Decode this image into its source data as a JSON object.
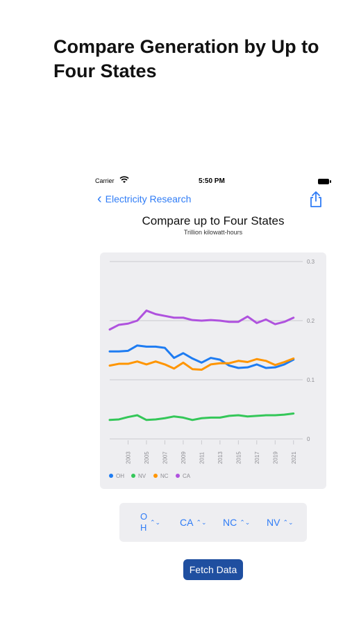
{
  "headline": "Compare Generation by Up to Four States",
  "status_bar": {
    "carrier": "Carrier",
    "time": "5:50 PM"
  },
  "nav": {
    "back_label": "Electricity Research"
  },
  "chart_header": {
    "title": "Compare up to Four States",
    "subtitle": "Trillion kilowatt-hours"
  },
  "chart_data": {
    "type": "line",
    "title": "Compare up to Four States",
    "subtitle": "Trillion kilowatt-hours",
    "x": [
      2001,
      2002,
      2003,
      2004,
      2005,
      2006,
      2007,
      2008,
      2009,
      2010,
      2011,
      2012,
      2013,
      2014,
      2015,
      2016,
      2017,
      2018,
      2019,
      2020,
      2021,
      2022
    ],
    "x_tick_labels": [
      "2003",
      "2005",
      "2007",
      "2009",
      "2011",
      "2013",
      "2015",
      "2017",
      "2019",
      "2021"
    ],
    "x_ticks": [
      2003,
      2005,
      2007,
      2009,
      2011,
      2013,
      2015,
      2017,
      2019,
      2021
    ],
    "y_ticks": [
      0,
      0.1,
      0.2,
      0.3
    ],
    "y_tick_labels": [
      "0",
      "0.1",
      "0.2",
      "0.3"
    ],
    "ylim": [
      0,
      0.3
    ],
    "grid": true,
    "legend_position": "bottom-left",
    "series": [
      {
        "name": "OH",
        "color": "#1e7cf2",
        "values": [
          0.148,
          0.148,
          0.149,
          0.158,
          0.156,
          0.156,
          0.154,
          0.137,
          0.145,
          0.136,
          0.129,
          0.137,
          0.134,
          0.124,
          0.12,
          0.121,
          0.126,
          0.12,
          0.121,
          0.126,
          0.134
        ]
      },
      {
        "name": "NV",
        "color": "#34c759",
        "values": [
          0.032,
          0.033,
          0.037,
          0.04,
          0.032,
          0.033,
          0.035,
          0.038,
          0.036,
          0.032,
          0.035,
          0.036,
          0.036,
          0.039,
          0.04,
          0.038,
          0.039,
          0.04,
          0.04,
          0.041,
          0.043
        ]
      },
      {
        "name": "NC",
        "color": "#ff9500",
        "values": [
          0.124,
          0.127,
          0.127,
          0.131,
          0.126,
          0.131,
          0.126,
          0.119,
          0.129,
          0.118,
          0.117,
          0.126,
          0.128,
          0.128,
          0.132,
          0.13,
          0.135,
          0.132,
          0.125,
          0.13,
          0.136
        ]
      },
      {
        "name": "CA",
        "color": "#af52de",
        "values": [
          0.185,
          0.193,
          0.195,
          0.2,
          0.217,
          0.211,
          0.208,
          0.205,
          0.205,
          0.201,
          0.2,
          0.201,
          0.2,
          0.198,
          0.198,
          0.207,
          0.196,
          0.202,
          0.194,
          0.198,
          0.205
        ]
      }
    ]
  },
  "pickers": [
    {
      "label": "OH"
    },
    {
      "label": "CA"
    },
    {
      "label": "NC"
    },
    {
      "label": "NV"
    }
  ],
  "fetch_button": {
    "label": "Fetch Data"
  }
}
